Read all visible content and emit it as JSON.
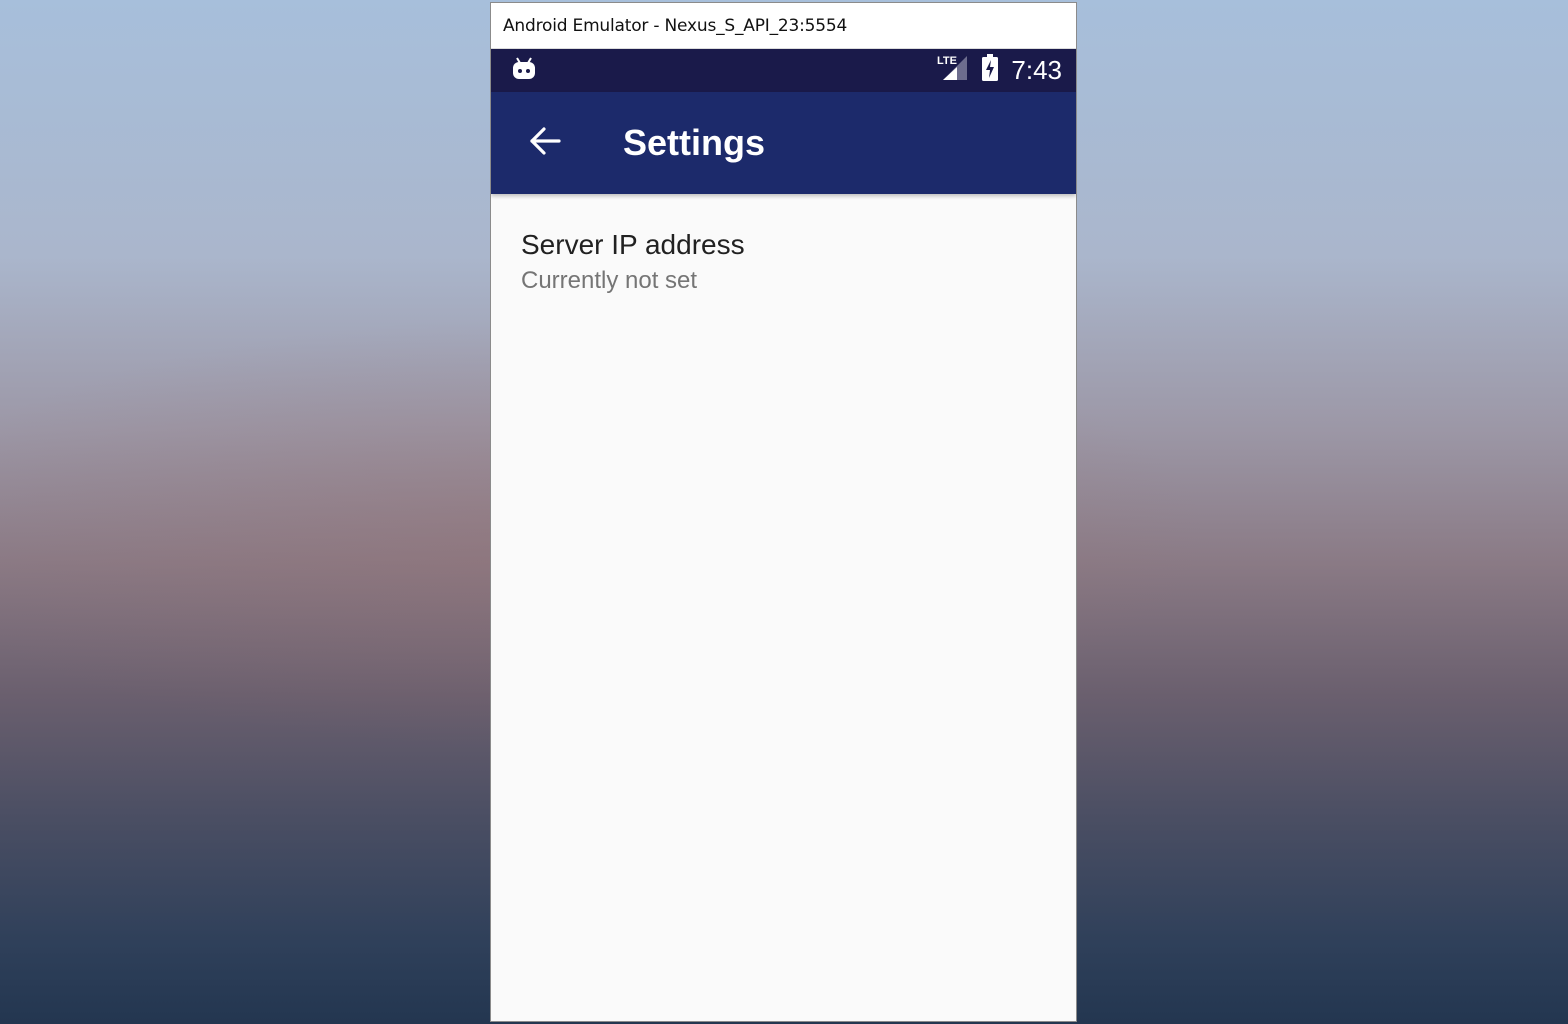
{
  "window": {
    "title": "Android Emulator - Nexus_S_API_23:5554"
  },
  "status_bar": {
    "time": "7:43",
    "network_label": "LTE",
    "icons": [
      "android-notification-icon",
      "lte-signal-icon",
      "battery-charging-icon"
    ]
  },
  "app_bar": {
    "title": "Settings",
    "back_icon": "arrow-back-icon"
  },
  "preferences": [
    {
      "title": "Server IP address",
      "summary": "Currently not set"
    }
  ],
  "colors": {
    "status_bar": "#1a1a4a",
    "app_bar": "#1c2a6b",
    "content_bg": "#fafafa",
    "primary_text": "#212121",
    "secondary_text": "#757575"
  }
}
